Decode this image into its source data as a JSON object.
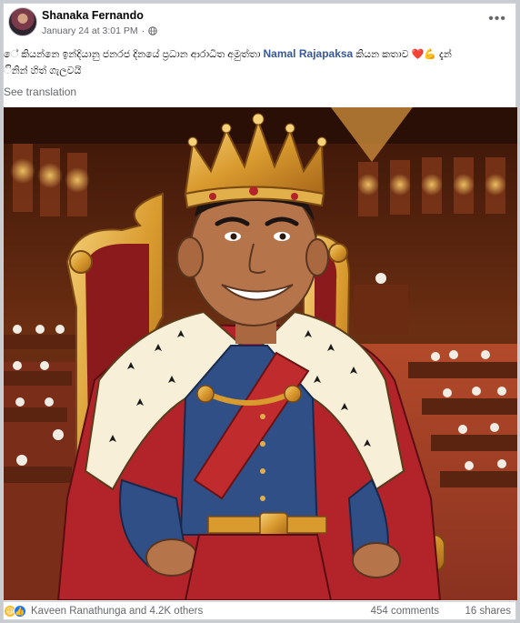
{
  "post": {
    "author": "Shanaka Fernando",
    "timestamp": "January 24 at 3:01 PM",
    "visibility_icon": "globe-icon",
    "more_label": "•••",
    "caption_before": "ේ කියන්නෙ ඉන්දියානු ජනරජ දිනයේ ප්‍රධාන ආරාධිත අමුත්තා ",
    "caption_mention": "Namal Rajapaksa",
    "caption_after": " කියන කතාව ❤️💪 දැන්",
    "caption_line2": "ිනින් හිත් ගැලවයි",
    "see_translation": "See translation",
    "image_alt": "Cartoon illustration of a smiling man wearing a gold crown and red royal robe with ermine trim, seated on a golden throne in a parliament chamber"
  },
  "footer": {
    "reaction_icons": [
      "haha-icon",
      "like-icon"
    ],
    "reactions_text": "Kaveen Ranathunga and 4.2K others",
    "comments": "454 comments",
    "shares": "16 shares"
  },
  "colors": {
    "link": "#385898",
    "secondary_text": "#65676b",
    "like_blue": "#1877f2",
    "haha_yellow": "#f7b928"
  }
}
